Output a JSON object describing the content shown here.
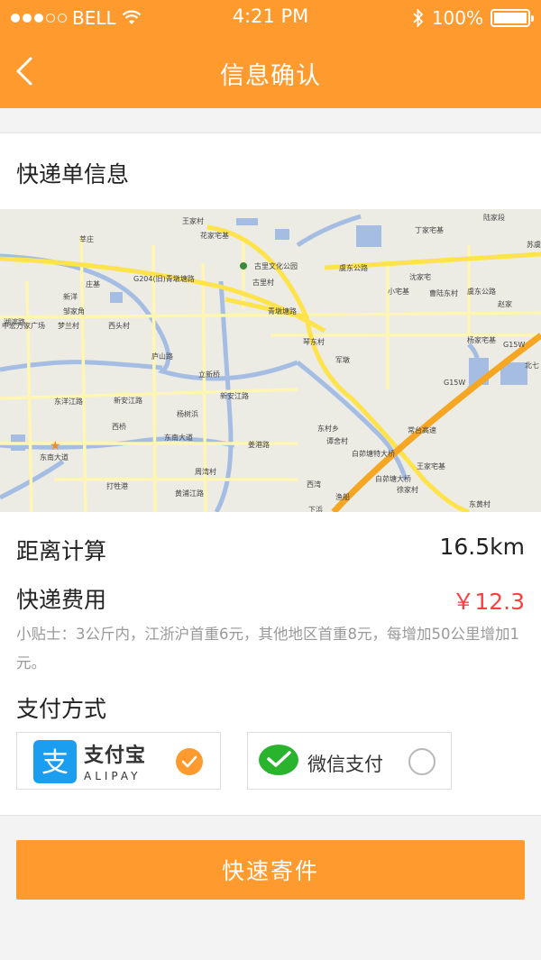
{
  "status_bar": {
    "carrier": "BELL",
    "time": "4:21 PM",
    "battery": "100%"
  },
  "nav": {
    "title": "信息确认",
    "back_icon": "chevron-left-icon"
  },
  "order": {
    "title": "快递单信息"
  },
  "map": {
    "labels": [
      "王家村",
      "花家宅基",
      "古里文化公园",
      "古里村",
      "青墩塘路",
      "G204(旧)青墩塘路",
      "琴东村",
      "军墩",
      "丁家宅基",
      "陆家段",
      "湖滨路",
      "莘庄",
      "庄基",
      "新洋",
      "邹家角",
      "梦兰村",
      "西头村",
      "东洋江路",
      "新安江路",
      "新安江路",
      "西桥",
      "杨树浜",
      "立新桥",
      "东南大道",
      "东南大道",
      "姜港路",
      "东村乡",
      "谭舍村",
      "白茆塘特大桥",
      "白茆塘大桥",
      "常台高速",
      "G15W",
      "G15W",
      "王家宅基",
      "徐家村",
      "打牲港",
      "黄浦江路",
      "周湾村",
      "西湾",
      "下浜",
      "渔船",
      "东黄村",
      "沈家宅",
      "小宅基",
      "曹陆东村",
      "虞东公路",
      "虞东公路",
      "杨家宅基",
      "赵家",
      "北七",
      "苏虞张",
      "中宏万家广场",
      "庐山路"
    ]
  },
  "distance": {
    "label": "距离计算",
    "value": "16.5km"
  },
  "fee": {
    "label": "快递费用",
    "value": "￥12.3",
    "tip": "小贴士：3公斤内，江浙沪首重6元，其他地区首重8元，每增加50公里增加1元。"
  },
  "payment": {
    "label": "支付方式",
    "alipay": {
      "name": "支付宝",
      "sub": "ALIPAY",
      "selected": true
    },
    "wechat": {
      "name": "微信支付",
      "selected": false
    }
  },
  "submit": {
    "label": "快速寄件"
  },
  "colors": {
    "accent": "#ff9a2e",
    "price": "#ff3f3f",
    "alipay": "#1b9ef0",
    "wechat": "#2ab42d"
  }
}
